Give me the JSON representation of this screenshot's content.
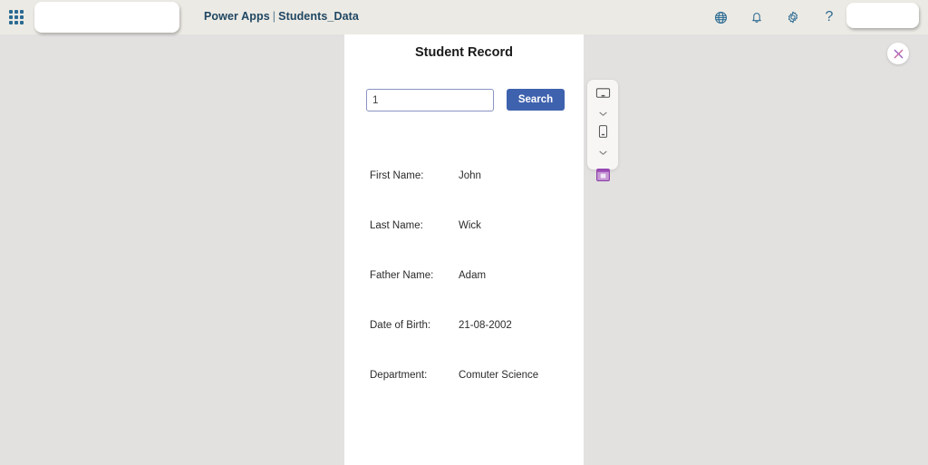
{
  "header": {
    "waffle_icon": "app-launcher-grid-icon",
    "redacted_left": "",
    "redacted_right": "",
    "brand": "Power Apps",
    "separator": "|",
    "app_name": "Students_Data",
    "icons": [
      {
        "name": "globe-icon",
        "glyph": "globe"
      },
      {
        "name": "notifications-bell-icon",
        "glyph": "bell"
      },
      {
        "name": "settings-gear-icon",
        "glyph": "gear"
      },
      {
        "name": "help-icon",
        "glyph": "?"
      }
    ],
    "background_color": "#eceae4",
    "text_color": "#1f4662"
  },
  "canvas": {
    "background_color": "#e2e1e0",
    "close_label": "close-icon"
  },
  "app": {
    "title": "Student Record",
    "search": {
      "value": "1",
      "placeholder": "",
      "button_label": "Search",
      "button_color": "#3f62ae",
      "border_color": "#8a93c4"
    },
    "fields": [
      {
        "label": "First Name:",
        "value": "John"
      },
      {
        "label": "Last Name:",
        "value": "Wick"
      },
      {
        "label": "Father Name:",
        "value": "Adam"
      },
      {
        "label": "Date of Birth:",
        "value": "21-08-2002"
      },
      {
        "label": "Department:",
        "value": "Comuter Science"
      }
    ]
  },
  "device_toolbar": {
    "items": [
      {
        "name": "monitor-preview-icon"
      },
      {
        "name": "monitor-chevron-down-icon"
      },
      {
        "name": "phone-preview-icon"
      },
      {
        "name": "phone-chevron-down-icon"
      },
      {
        "name": "app-preview-icon",
        "color": "#9b4bb5"
      }
    ]
  }
}
